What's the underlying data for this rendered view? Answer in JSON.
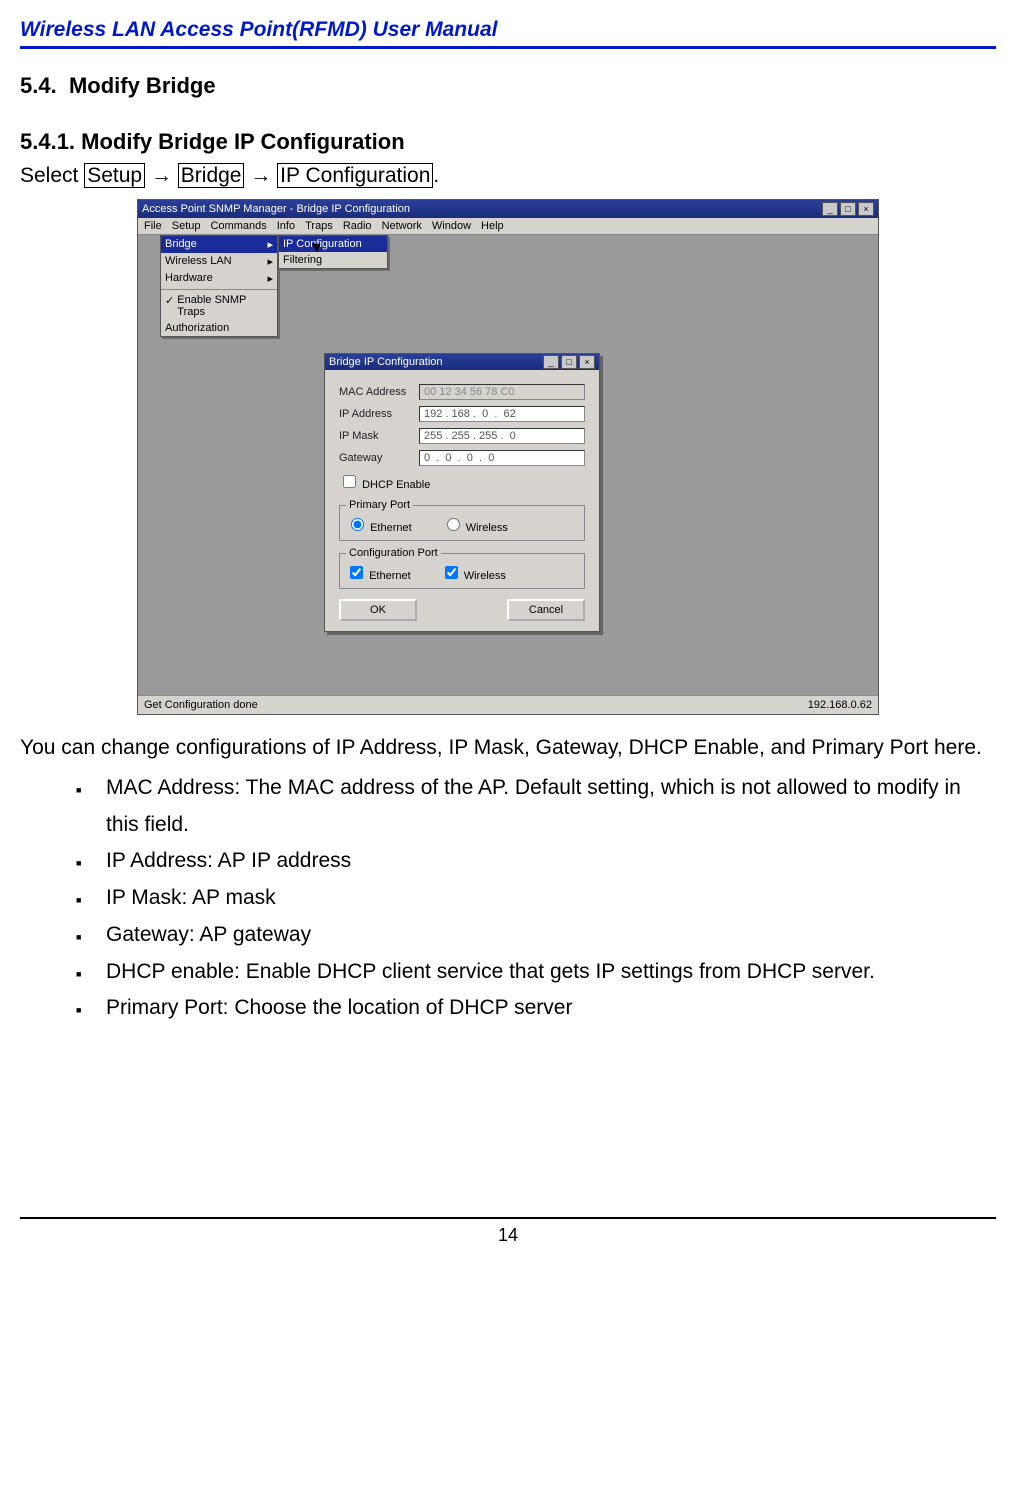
{
  "header": {
    "title": "Wireless LAN Access Point(RFMD) User Manual"
  },
  "section": {
    "h2_num": "5.4.",
    "h2_title": "Modify Bridge",
    "h3_num": "5.4.1.",
    "h3_title": "Modify Bridge IP Configuration",
    "select_word": "Select ",
    "nav_setup": "Setup",
    "nav_bridge": "Bridge",
    "nav_ipconfig": "IP Configuration",
    "arrow": " → ",
    "period": "."
  },
  "screenshot": {
    "main_title": "Access Point SNMP Manager - Bridge IP Configuration",
    "menus": {
      "file": "File",
      "setup": "Setup",
      "commands": "Commands",
      "info": "Info",
      "traps": "Traps",
      "radio": "Radio",
      "network": "Network",
      "window": "Window",
      "help": "Help"
    },
    "setup_menu": {
      "bridge": "Bridge",
      "wlan": "Wireless LAN",
      "hardware": "Hardware",
      "snmp_traps": "Enable SNMP Traps",
      "auth": "Authorization"
    },
    "bridge_submenu": {
      "ipconfig": "IP Configuration",
      "filtering": "Filtering"
    },
    "dialog": {
      "title": "Bridge IP Configuration",
      "mac_label": "MAC Address",
      "mac_value": "00 12 34 56 78 C0",
      "ip_label": "IP Address",
      "ip_value": "192 . 168 .  0  .  62",
      "mask_label": "IP Mask",
      "mask_value": "255 . 255 . 255 .  0",
      "gw_label": "Gateway",
      "gw_value": "0  .  0  .  0  .  0",
      "dhcp_enable": "DHCP Enable",
      "primary_port_legend": "Primary Port",
      "config_port_legend": "Configuration Port",
      "ethernet": "Ethernet",
      "wireless": "Wireless",
      "ok": "OK",
      "cancel": "Cancel"
    },
    "status_left": "Get Configuration done",
    "status_right": "192.168.0.62",
    "win_controls": {
      "min": "_",
      "max": "□",
      "close": "×"
    }
  },
  "body": {
    "intro": "You can change configurations of IP Address, IP Mask, Gateway, DHCP Enable, and Primary Port here.",
    "bullets": [
      "MAC Address: The MAC address of the AP. Default setting, which is not allowed to modify in this field.",
      "IP Address: AP IP address",
      "IP Mask: AP mask",
      "Gateway: AP gateway",
      "DHCP enable: Enable DHCP client service that gets IP settings from DHCP server.",
      "Primary Port: Choose the location of DHCP server"
    ]
  },
  "footer": {
    "page_number": "14"
  }
}
